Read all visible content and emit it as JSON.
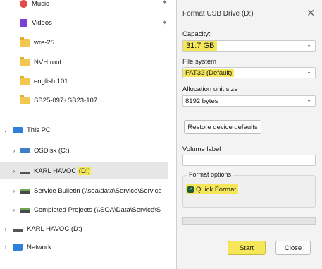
{
  "explorer": {
    "items": [
      {
        "label": "Music",
        "icon": "music-icon",
        "pinned": true
      },
      {
        "label": "Videos",
        "icon": "video-folder-icon",
        "pinned": true
      },
      {
        "label": "wre-25",
        "icon": "folder-icon"
      },
      {
        "label": "NVH roof",
        "icon": "folder-icon"
      },
      {
        "label": "english 101",
        "icon": "folder-icon"
      },
      {
        "label": "SB25-097+SB23-107",
        "icon": "folder-icon"
      }
    ],
    "this_pc": "This PC",
    "osdisk": "OSDisk (C:)",
    "karl_selected_name": "KARL HAVOC",
    "karl_selected_letter": "(D:)",
    "service_bulletin": "Service Bulletin (\\\\soa\\data\\Service\\Service",
    "completed_projects": "Completed Projects (\\\\SOA\\Data\\Service\\S",
    "karl_bottom": "KARL HAVOC (D:)",
    "network": "Network"
  },
  "dialog": {
    "title": "Format USB Drive (D:)",
    "capacity_label": "Capacity:",
    "capacity_value": "31.7 GB",
    "filesystem_label": "File system",
    "filesystem_value": "FAT32 (Default)",
    "alloc_label": "Allocation unit size",
    "alloc_value": "8192 bytes",
    "restore_button": "Restore device defaults",
    "volume_label": "Volume label",
    "volume_value": "",
    "format_options_label": "Format options",
    "quick_format_label": "Quick Format",
    "quick_format_checked": true,
    "progress": 0,
    "start_button": "Start",
    "close_button": "Close"
  },
  "colors": {
    "highlight": "#f5e65a",
    "selected_row": "#e6e6e6",
    "dialog_bg": "#f3f3f3"
  }
}
